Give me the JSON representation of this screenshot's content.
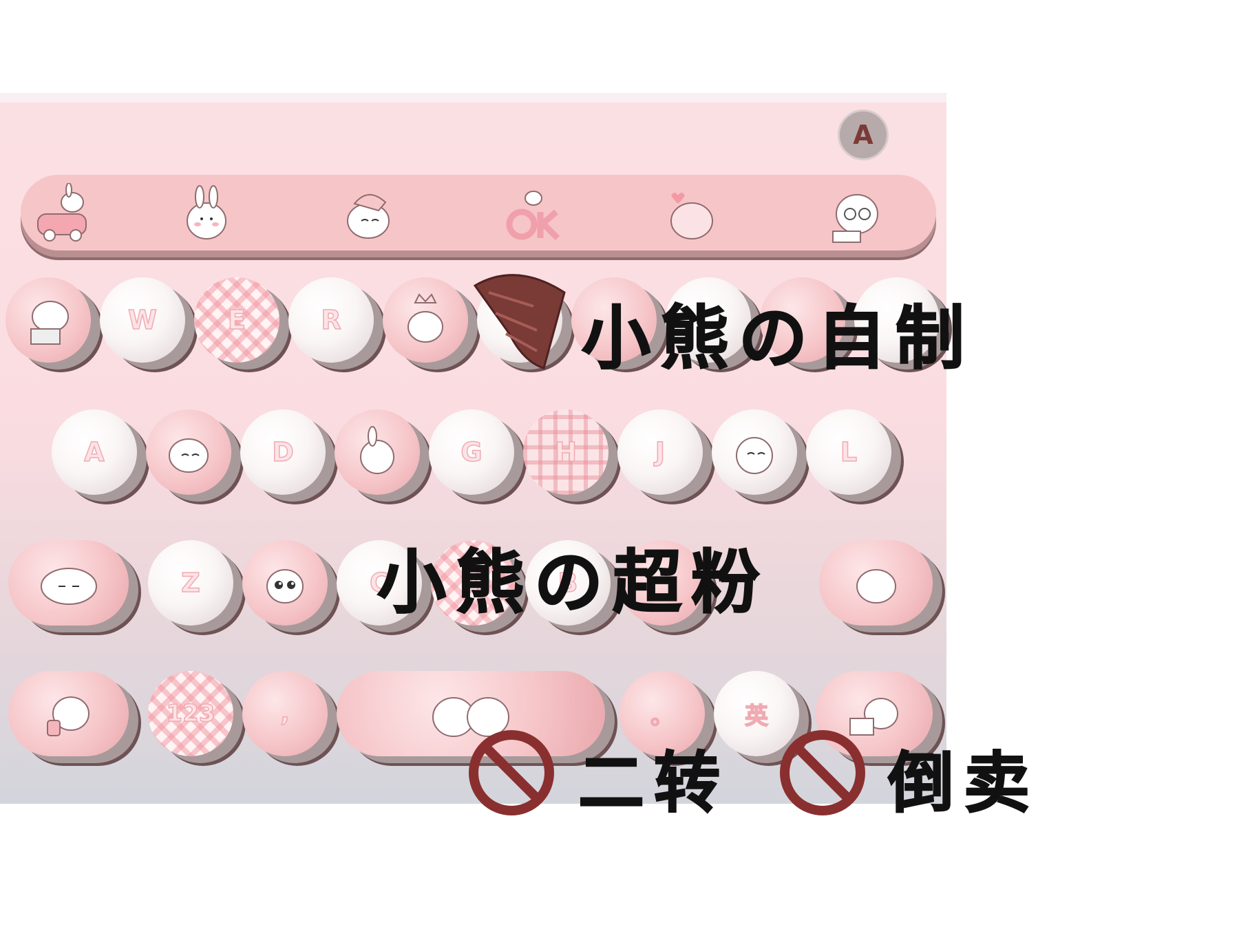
{
  "keyboard": {
    "switch_label": "A",
    "row1": [
      "",
      "W",
      "E",
      "R",
      "",
      "",
      "",
      "",
      "",
      ""
    ],
    "row2": [
      "A",
      "",
      "D",
      "",
      "G",
      "H",
      "J",
      "",
      "L"
    ],
    "row3": [
      "",
      "Z",
      "",
      "C",
      "V",
      "B",
      "",
      ""
    ],
    "row4": [
      "",
      "123",
      ",",
      "",
      "。",
      "英",
      ""
    ]
  },
  "overlay": {
    "line1": "小熊の自制",
    "line2": "小熊の超粉",
    "line3_a": "二转",
    "line3_b": "倒卖"
  },
  "colors": {
    "key_pink": "#f6c6c9",
    "key_white": "#fbf6f6",
    "key_shadow": "#6e5254",
    "legend": "#fde3e6",
    "no_sign": "#8a2f2f"
  }
}
